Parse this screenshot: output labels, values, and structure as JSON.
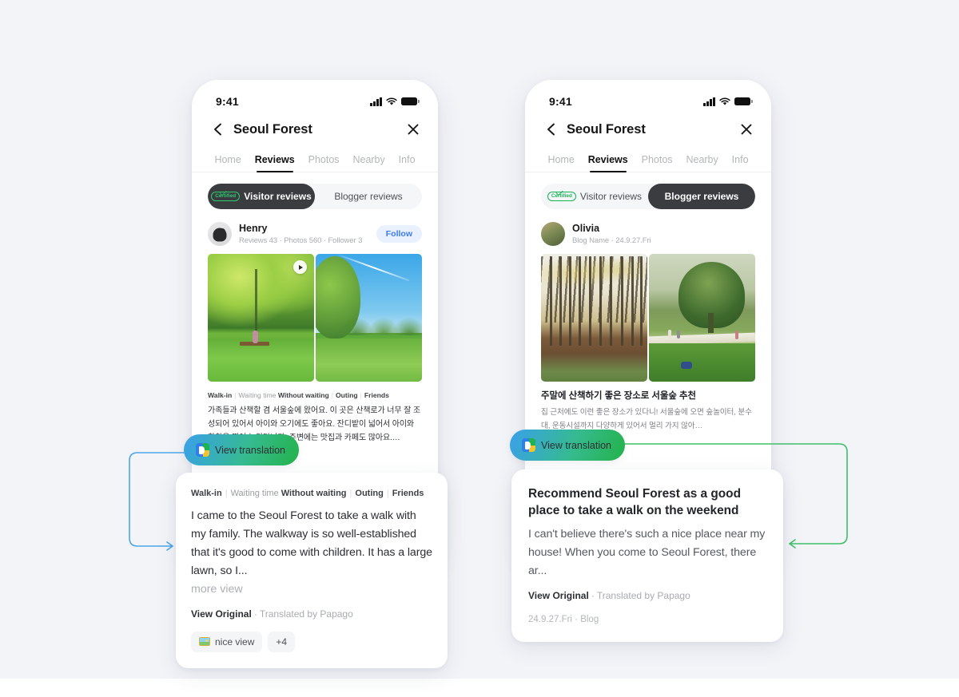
{
  "page": {
    "background_color": "#f3f4f8",
    "accent_blue": "#3aa0ea",
    "accent_green": "#23b24a"
  },
  "phones": [
    {
      "id": "left",
      "status": {
        "time": "9:41",
        "signal_icon": "cellular-bars-icon",
        "wifi_icon": "wifi-icon",
        "battery_icon": "battery-full-icon"
      },
      "nav": {
        "back_icon": "chevron-left-icon",
        "title": "Seoul Forest",
        "close_icon": "close-icon"
      },
      "tabs": [
        {
          "label": "Home",
          "active": false
        },
        {
          "label": "Reviews",
          "active": true
        },
        {
          "label": "Photos",
          "active": false
        },
        {
          "label": "Nearby",
          "active": false
        },
        {
          "label": "Info",
          "active": false
        }
      ],
      "segments": [
        {
          "label": "Visitor reviews",
          "badge": "Certified",
          "active": true
        },
        {
          "label": "Blogger reviews",
          "badge": null,
          "active": false
        }
      ],
      "reviewer": {
        "name": "Henry",
        "meta": "Reviews 43 · Photos 560 · Follower 3",
        "follow_label": "Follow",
        "avatar_icon": "avatar-henry"
      },
      "photos": [
        {
          "alt_name": "willow-park-photo",
          "has_play": true
        },
        {
          "alt_name": "blue-sky-lawn-photo",
          "has_play": false
        }
      ],
      "review": {
        "keywords": [
          {
            "label": "Walk-in",
            "bold": true
          },
          {
            "label": "Waiting time",
            "bold": false
          },
          {
            "label": "Without waiting",
            "bold": true,
            "inline_with_prev": true
          },
          {
            "label": "Outing",
            "bold": true
          },
          {
            "label": "Friends",
            "bold": true
          }
        ],
        "body": "가족들과 산책할 겸 서울숲에 왔어요. 이 곳은 산책로가 너무 잘 조성되어 있어서 아이와 오기에도 좋아요. 잔디밭이 넓어서 아이와 한참을 뛰어 놀았답니다. 주변에는 맛집과 카페도 많아요.…"
      },
      "view_translation": {
        "label": "View translation",
        "icon": "papago-translate-icon"
      },
      "translated_card": {
        "keywords_plain": "Walk-in | Waiting time Without waiting | Outing | Friends",
        "keywords": [
          {
            "label": "Walk-in",
            "bold": true
          },
          {
            "label": "Waiting time",
            "bold": false
          },
          {
            "label": "Without waiting",
            "bold": true,
            "inline_with_prev": true
          },
          {
            "label": "Outing",
            "bold": true
          },
          {
            "label": "Friends",
            "bold": true
          }
        ],
        "body": "I came to the Seoul Forest to take a walk with my family. The walkway is so well-established that it's good to come with children. It has a large lawn, so I...",
        "more_label": "more view",
        "view_original_label": "View Original",
        "translated_by": "Translated by Papago",
        "separator": "·",
        "tags": [
          {
            "label": "nice view",
            "emoji_icon": "landscape-emoji"
          },
          {
            "label": "+4",
            "emoji_icon": null
          }
        ]
      }
    },
    {
      "id": "right",
      "status": {
        "time": "9:41",
        "signal_icon": "cellular-bars-icon",
        "wifi_icon": "wifi-icon",
        "battery_icon": "battery-full-icon"
      },
      "nav": {
        "back_icon": "chevron-left-icon",
        "title": "Seoul Forest",
        "close_icon": "close-icon"
      },
      "tabs": [
        {
          "label": "Home",
          "active": false
        },
        {
          "label": "Reviews",
          "active": true
        },
        {
          "label": "Photos",
          "active": false
        },
        {
          "label": "Nearby",
          "active": false
        },
        {
          "label": "Info",
          "active": false
        }
      ],
      "segments": [
        {
          "label": "Visitor reviews",
          "badge": "Certified",
          "active": false
        },
        {
          "label": "Blogger reviews",
          "badge": null,
          "active": true
        }
      ],
      "reviewer": {
        "name": "Olivia",
        "meta": "Blog Name · 24.9.27.Fri",
        "follow_label": null,
        "avatar_icon": "avatar-olivia"
      },
      "photos": [
        {
          "alt_name": "autumn-forest-photo",
          "has_play": false
        },
        {
          "alt_name": "big-tree-lawn-photo",
          "has_play": false
        }
      ],
      "review": {
        "title": "주말에 산책하기 좋은 장소로 서울숲 추천",
        "body": "집 근처에도 이런 좋은 장소가 있다니! 서울숲에 오면 숲놀이터, 분수대, 운동시설까지 다양하게 있어서 멀리 가지 않아…"
      },
      "view_translation": {
        "label": "View translation",
        "icon": "papago-translate-icon"
      },
      "translated_card": {
        "title": "Recommend Seoul Forest as a good place to take a walk on the weekend",
        "body": "I can't believe there's such a nice place near my house! When you come to Seoul Forest, there ar...",
        "view_original_label": "View Original",
        "translated_by": "Translated by Papago",
        "separator": "·",
        "date_meta": "24.9.27.Fri · Blog"
      }
    }
  ]
}
